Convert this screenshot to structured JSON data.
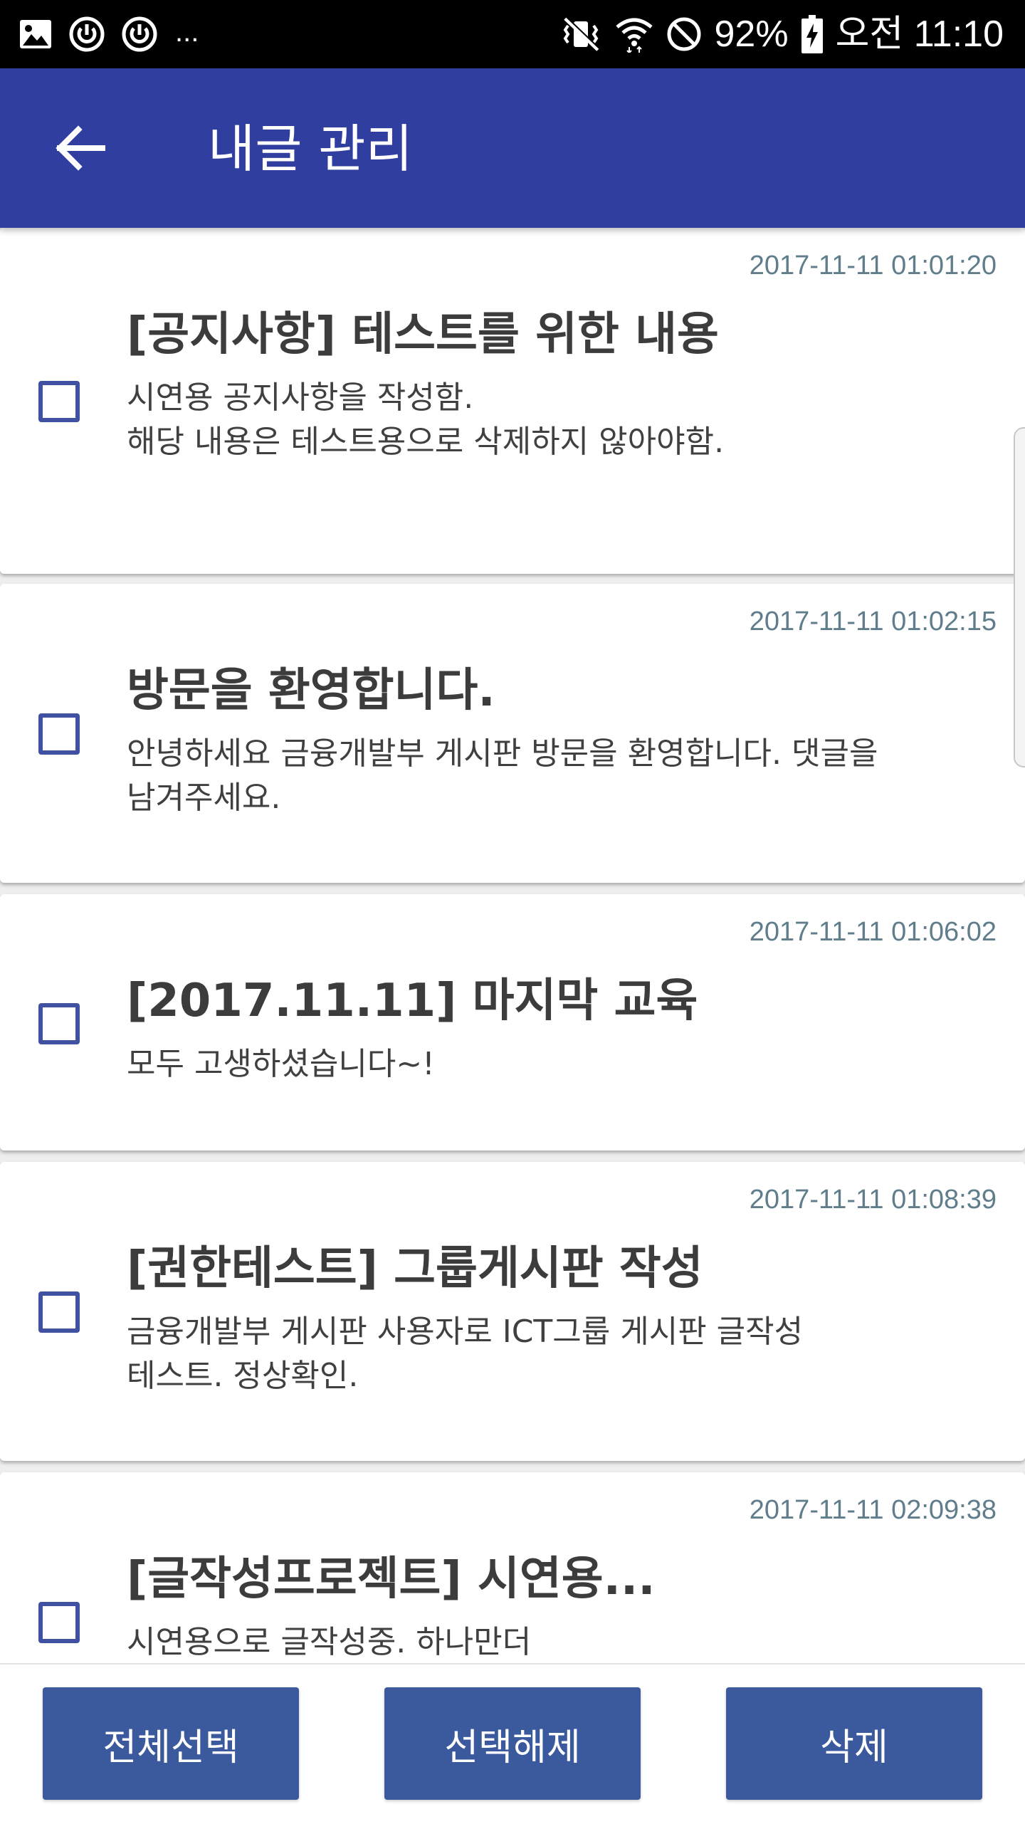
{
  "status_bar": {
    "notification_icons": [
      "gallery-icon",
      "power-ring-icon",
      "power-ring-icon"
    ],
    "more_indicator": "...",
    "system_icons": [
      "vibrate-mute-icon",
      "wifi-icon",
      "no-sign-icon",
      "battery-charging-icon"
    ],
    "battery": "92%",
    "time": "오전 11:10"
  },
  "app_bar": {
    "back_icon": "arrow-left-icon",
    "title": "내글 관리"
  },
  "posts": [
    {
      "date": "2017-11-11 01:01:20",
      "title": "[공지사항] 테스트를 위한 내용",
      "body": [
        "시연용 공지사항을 작성함.",
        "해당 내용은 테스트용으로 삭제하지 않아야함."
      ],
      "checked": false
    },
    {
      "date": "2017-11-11 01:02:15",
      "title": "방문을 환영합니다.",
      "body": [
        "안녕하세요 금융개발부 게시판 방문을 환영합니다. 댓글을",
        "남겨주세요."
      ],
      "checked": false
    },
    {
      "date": "2017-11-11 01:06:02",
      "title": "[2017.11.11] 마지막 교육",
      "body": [
        "모두 고생하셨습니다~!"
      ],
      "checked": false
    },
    {
      "date": "2017-11-11 01:08:39",
      "title": "[권한테스트] 그룹게시판 작성",
      "body": [
        "금융개발부 게시판 사용자로 ICT그룹 게시판 글작성",
        "테스트. 정상확인."
      ],
      "checked": false
    },
    {
      "date": "2017-11-11 02:09:38",
      "title": "[글작성프로젝트] 시연용...",
      "body": [
        "시연용으로 글작성중. 하나만더"
      ],
      "checked": false
    }
  ],
  "actions": {
    "select_all": "전체선택",
    "deselect": "선택해제",
    "delete": "삭제"
  },
  "colors": {
    "app_bar": "#303f9f",
    "button": "#3b5a9e",
    "checkbox": "#3f51a0",
    "date": "#607d8b",
    "background": "#eeeeee"
  }
}
